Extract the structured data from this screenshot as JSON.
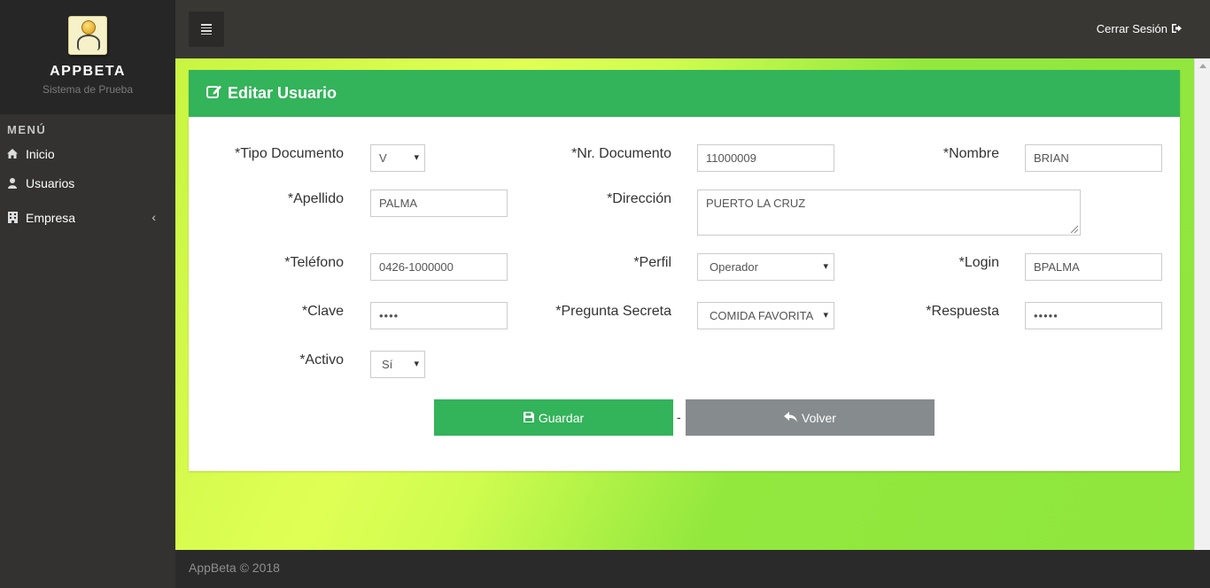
{
  "brand": {
    "name": "APPBETA",
    "subtitle": "Sistema de Prueba"
  },
  "sidebar": {
    "menu_title": "MENÚ",
    "items": [
      {
        "label": "Inicio",
        "icon": "home-icon"
      },
      {
        "label": "Usuarios",
        "icon": "user-icon"
      },
      {
        "label": "Empresa",
        "icon": "building-icon",
        "chevron": "‹"
      }
    ]
  },
  "topbar": {
    "logout_label": "Cerrar Sesión"
  },
  "panel": {
    "title": "Editar Usuario"
  },
  "form": {
    "tipo_documento": {
      "label": "*Tipo Documento",
      "value": "V"
    },
    "nr_documento": {
      "label": "*Nr. Documento",
      "value": "11000009"
    },
    "nombre": {
      "label": "*Nombre",
      "value": "BRIAN"
    },
    "apellido": {
      "label": "*Apellido",
      "value": "PALMA"
    },
    "direccion": {
      "label": "*Dirección",
      "value": "PUERTO LA CRUZ"
    },
    "telefono": {
      "label": "*Teléfono",
      "value": "0426-1000000"
    },
    "perfil": {
      "label": "*Perfil",
      "value": "Operador"
    },
    "login": {
      "label": "*Login",
      "value": "BPALMA"
    },
    "clave": {
      "label": "*Clave",
      "value": "••••"
    },
    "pregunta": {
      "label": "*Pregunta Secreta",
      "value": "COMIDA FAVORITA"
    },
    "respuesta": {
      "label": "*Respuesta",
      "value": "•••••"
    },
    "activo": {
      "label": "*Activo",
      "value": "Sí"
    }
  },
  "buttons": {
    "save_label": "Guardar",
    "back_label": "Volver",
    "separator": "-"
  },
  "footer": {
    "text": "AppBeta © 2018"
  },
  "colors": {
    "accent": "#33b35a",
    "back_button": "#868b8e",
    "sidebar": "#333230",
    "topbar": "#383734"
  }
}
